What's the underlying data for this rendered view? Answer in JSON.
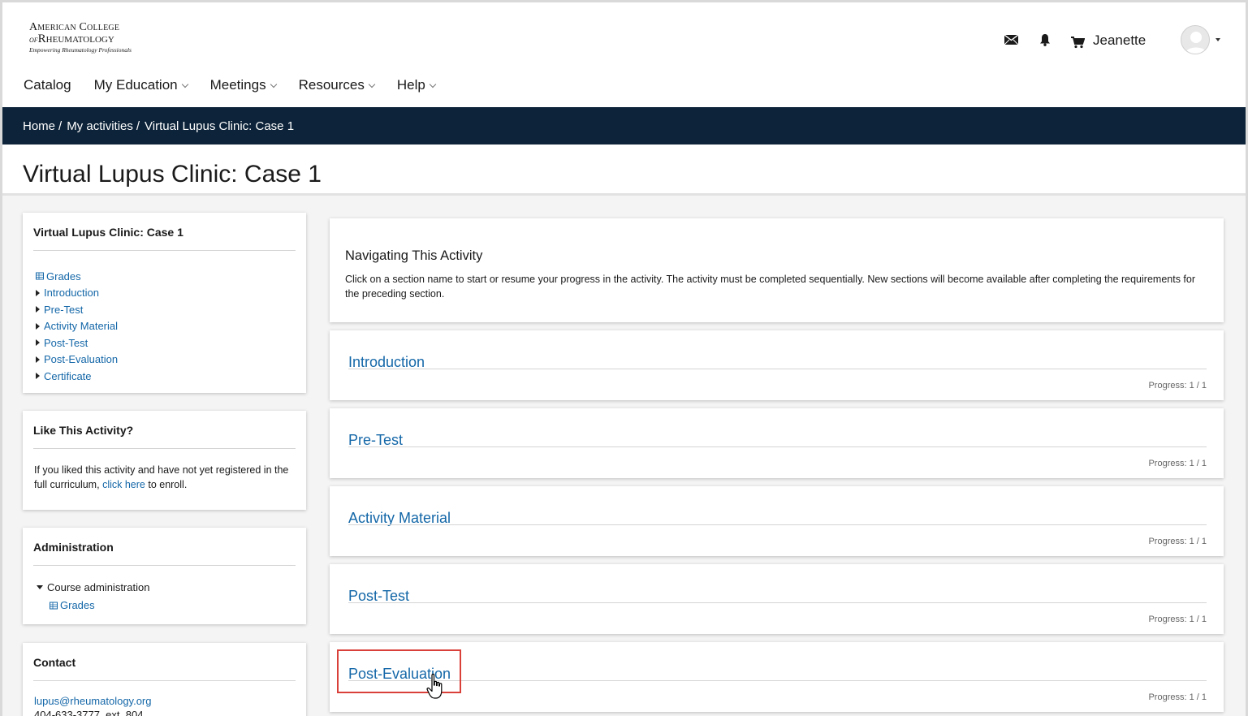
{
  "logo": {
    "line1": "American College",
    "line2_prefix": "of",
    "line2": "Rheumatology",
    "tagline": "Empowering Rheumatology Professionals"
  },
  "user": {
    "name": "Jeanette"
  },
  "icons": {
    "mail": "envelope-icon",
    "notifications": "bell-icon",
    "cart": "cart-icon",
    "avatar": "user-avatar-icon"
  },
  "nav": {
    "catalog": "Catalog",
    "my_education": "My Education",
    "meetings": "Meetings",
    "resources": "Resources",
    "help": "Help"
  },
  "breadcrumb": {
    "home": "Home",
    "my_activities": "My activities",
    "current": "Virtual Lupus Clinic: Case 1"
  },
  "page_title": "Virtual Lupus Clinic: Case 1",
  "sidebar": {
    "course_card": {
      "title": "Virtual Lupus Clinic: Case 1",
      "items": [
        "Grades",
        "Introduction",
        "Pre-Test",
        "Activity Material",
        "Post-Test",
        "Post-Evaluation",
        "Certificate"
      ]
    },
    "like_card": {
      "title": "Like This Activity?",
      "text_before": "If you liked this activity and have not yet registered in the full curriculum,",
      "link": "click here",
      "text_after": "to enroll."
    },
    "admin_card": {
      "title": "Administration",
      "course_admin": "Course administration",
      "grades": "Grades"
    },
    "contact_card": {
      "title": "Contact",
      "email": "lupus@rheumatology.org",
      "phone": "404-633-3777, ext. 804"
    }
  },
  "intro_box": {
    "heading": "Navigating This Activity",
    "text": "Click on a section name to start or resume your progress in the activity. The activity must be completed sequentially. New sections will become available after completing the requirements for the preceding section."
  },
  "sections": [
    {
      "name": "Introduction",
      "progress": "Progress: 1 / 1"
    },
    {
      "name": "Pre-Test",
      "progress": "Progress: 1 / 1"
    },
    {
      "name": "Activity Material",
      "progress": "Progress: 1 / 1"
    },
    {
      "name": "Post-Test",
      "progress": "Progress: 1 / 1"
    },
    {
      "name": "Post-Evaluation",
      "progress": "Progress: 1 / 1"
    }
  ],
  "colors": {
    "navy": "#0c2339",
    "link": "#1467a8",
    "highlight": "#d9403a"
  }
}
